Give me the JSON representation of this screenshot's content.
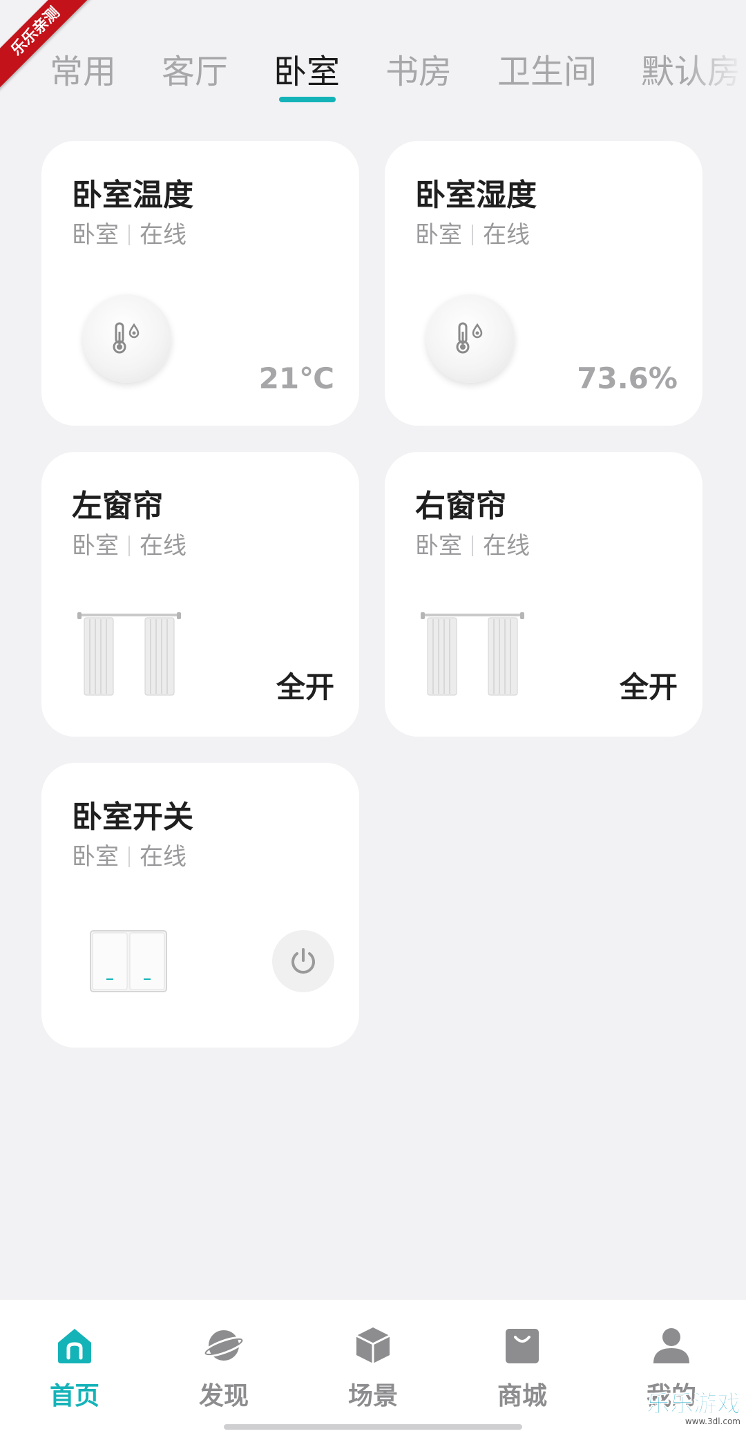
{
  "watermark": {
    "ribbon": "乐乐亲测",
    "brand": "乐乐游戏",
    "url": "www.3dl.com"
  },
  "tabs": [
    {
      "label": "常用"
    },
    {
      "label": "客厅"
    },
    {
      "label": "卧室",
      "active": true
    },
    {
      "label": "书房"
    },
    {
      "label": "卫生间"
    },
    {
      "label": "默认房"
    }
  ],
  "accent_color": "#14b3b8",
  "devices": [
    {
      "name": "卧室温度",
      "room": "卧室",
      "status": "在线",
      "icon": "temperature-humidity-sensor-icon",
      "value": "21℃"
    },
    {
      "name": "卧室湿度",
      "room": "卧室",
      "status": "在线",
      "icon": "temperature-humidity-sensor-icon",
      "value": "73.6%"
    },
    {
      "name": "左窗帘",
      "room": "卧室",
      "status": "在线",
      "icon": "curtain-icon",
      "value": "全开"
    },
    {
      "name": "右窗帘",
      "room": "卧室",
      "status": "在线",
      "icon": "curtain-icon",
      "value": "全开"
    },
    {
      "name": "卧室开关",
      "room": "卧室",
      "status": "在线",
      "icon": "wall-switch-icon",
      "control": "power-icon"
    }
  ],
  "bottom_nav": [
    {
      "label": "首页",
      "icon": "home-icon",
      "active": true
    },
    {
      "label": "发现",
      "icon": "planet-icon"
    },
    {
      "label": "场景",
      "icon": "cube-icon"
    },
    {
      "label": "商城",
      "icon": "shopping-bag-icon"
    },
    {
      "label": "我的",
      "icon": "person-icon"
    }
  ]
}
